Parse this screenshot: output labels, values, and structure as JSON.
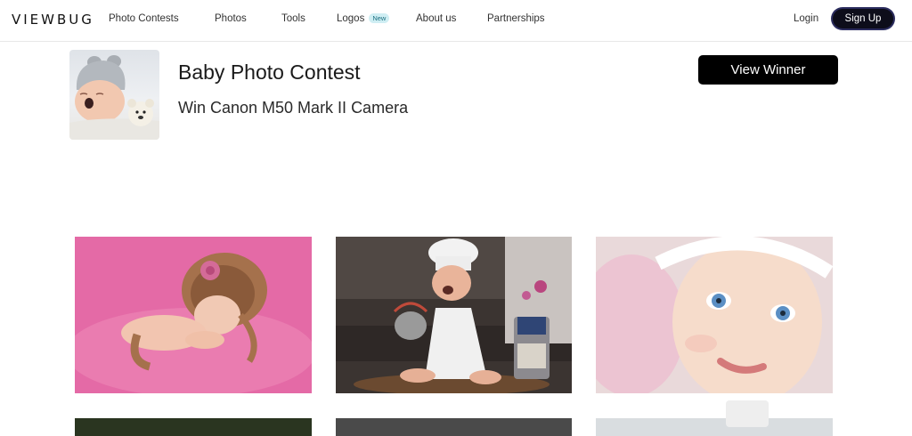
{
  "nav": {
    "logo": "VIEWBUG",
    "items": [
      {
        "label": "Photo Contests"
      },
      {
        "label": "Photos"
      },
      {
        "label": "Tools"
      },
      {
        "label": "Logos",
        "badge": "New"
      },
      {
        "label": "About us"
      },
      {
        "label": "Partnerships"
      }
    ],
    "login": "Login",
    "signup": "Sign Up"
  },
  "contest": {
    "title": "Baby Photo Contest",
    "subtitle": "Win Canon M50 Mark II Camera",
    "view_winner": "View Winner"
  },
  "gallery": {
    "photos": [
      {
        "subject": "sleeping newborn in lion hat on pink blanket"
      },
      {
        "subject": "baby chef laughing in kitchen"
      },
      {
        "subject": "blue-eyed toddler with white lace headband"
      },
      {
        "subject": "photo (partially visible)"
      },
      {
        "subject": "photo (partially visible)"
      },
      {
        "subject": "photo (partially visible)"
      }
    ]
  },
  "colors": {
    "signup_bg": "#0d0d1a",
    "winner_bg": "#000000",
    "badge_bg": "#cfeef3"
  }
}
